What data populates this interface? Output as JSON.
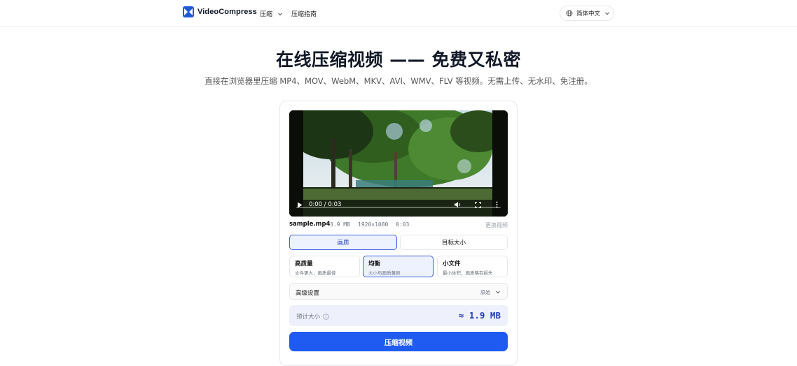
{
  "header": {
    "brand": "VideoCompress",
    "nav": {
      "compress": "压缩",
      "guide": "压缩指南"
    },
    "language": "简体中文"
  },
  "hero": {
    "title": "在线压缩视频 —— 免费又私密",
    "subtitle": "直接在浏览器里压缩 MP4、MOV、WebM、MKV、AVI、WMV、FLV 等视频。无需上传、无水印、免注册。"
  },
  "player": {
    "time": "0:00 / 0:03",
    "progress_fraction": 0
  },
  "file": {
    "name": "sample.mp4",
    "size": "3.9 MB",
    "resolution": "1920×1080",
    "duration": "0:03",
    "replace_label": "更换视频"
  },
  "mode_tabs": {
    "quality": "画质",
    "target_size": "目标大小"
  },
  "presets": [
    {
      "title": "高质量",
      "desc": "文件更大，画质最佳"
    },
    {
      "title": "均衡",
      "desc": "大小与画质兼顾"
    },
    {
      "title": "小文件",
      "desc": "最小体积，画质略有损失"
    }
  ],
  "advanced": {
    "label": "高级设置",
    "value": "原始"
  },
  "estimate": {
    "label": "预计大小",
    "value": "≈ 1.9 MB"
  },
  "cta": {
    "label": "压缩视频"
  },
  "colors": {
    "accent": "#1f5bf0",
    "accent_soft": "#eef2ff",
    "accent_border": "#3b5bdb"
  }
}
